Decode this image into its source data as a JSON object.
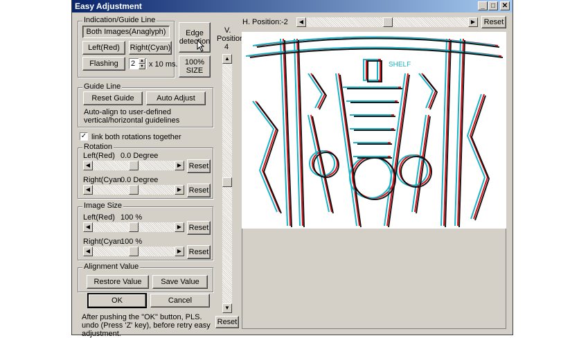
{
  "window": {
    "title": "Easy Adjustment"
  },
  "titlebar_buttons": {
    "minimize": "_",
    "maximize": "□",
    "close": "✕"
  },
  "indication": {
    "legend": "Indication/Guide Line",
    "both_images": "Both Images(Anaglyph)",
    "left_red": "Left(Red)",
    "right_cyan": "Right(Cyan)",
    "flashing": "Flashing",
    "flash_value": "2",
    "flash_unit": "x 10 ms."
  },
  "edge_detection": "Edge detection",
  "size100": "100% SIZE",
  "guide_line": {
    "legend": "Guide Line",
    "reset_guide": "Reset Guide",
    "auto_adjust": "Auto Adjust",
    "note": "Auto-align to user-defined vertical/horizontal guidelines"
  },
  "link_rotations": {
    "label": "link both rotations together",
    "checked": true,
    "mark": "✓"
  },
  "rotation": {
    "legend": "Rotation",
    "left_label": "Left(Red)",
    "left_value": "0.0 Degree",
    "right_label": "Right(Cyan",
    "right_value": "0.0 Degree",
    "reset": "Reset"
  },
  "image_size": {
    "legend": "Image Size",
    "left_label": "Left(Red)",
    "left_value": "100 %",
    "right_label": "Right(Cyan",
    "right_value": "100 %",
    "reset": "Reset"
  },
  "alignment": {
    "legend": "Alignment Value",
    "restore": "Restore Value",
    "save": "Save Value"
  },
  "ok": "OK",
  "cancel": "Cancel",
  "footer_note": "After pushing the \"OK\" button, PLS. undo (Press 'Z' key), before retry easy adjustment.",
  "v_position": {
    "label1": "V.",
    "label2": "Position",
    "value": "4",
    "reset": "Reset"
  },
  "h_position": {
    "label": "H. Position:",
    "value": "-2",
    "reset": "Reset"
  },
  "arrows": {
    "left": "◀",
    "right": "▶",
    "up": "▲",
    "down": "▼"
  },
  "preview_text": "SHELF",
  "colors": {
    "red": "#d8141c",
    "cyan": "#18b4c8",
    "title_start": "#0a246a",
    "title_end": "#a6caf0",
    "face": "#d4d0c8"
  }
}
